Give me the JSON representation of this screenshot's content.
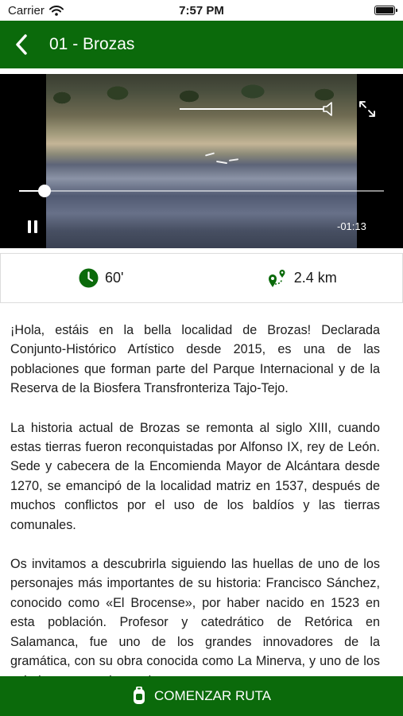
{
  "status_bar": {
    "carrier": "Carrier",
    "time": "7:57 PM"
  },
  "header": {
    "title": "01 - Brozas"
  },
  "video": {
    "time_remaining": "-01:13",
    "progress": 0.07,
    "volume": 1.0
  },
  "info": {
    "duration": "60'",
    "distance": "2.4 km"
  },
  "colors": {
    "brand_green": "#0b6a0b"
  },
  "icons": {
    "back": "chevron-left-icon",
    "duration": "clock-icon",
    "distance": "route-pin-icon",
    "start": "hiker-icon"
  },
  "content": {
    "paragraphs": [
      "¡Hola, estáis en la bella localidad de Brozas! Declarada Conjunto-Histórico Artístico desde 2015, es una de las poblaciones que forman parte del Parque Internacional y de la Reserva de la Biosfera Transfronteriza Tajo-Tejo.",
      "La historia actual de Brozas se remonta al siglo XIII, cuando estas tierras fueron reconquistadas por Alfonso IX, rey de León. Sede y cabecera de la Encomienda Mayor de Alcántara desde 1270, se emancipó de la localidad matriz en 1537, después de muchos conflictos por el uso de los baldíos y las tierras comunales.",
      "Os invitamos a descubrirla siguiendo las huellas de uno de los personajes más importantes de su historia: Francisco Sánchez, conocido como «El Brocense», por haber nacido en 1523 en esta población. Profesor y catedrático de Retórica en Salamanca, fue uno de los grandes innovadores de la gramática, con su obra conocida como La Minerva, y uno de los más importantes humanistas europeos."
    ]
  },
  "footer": {
    "start_label": "COMENZAR RUTA"
  }
}
